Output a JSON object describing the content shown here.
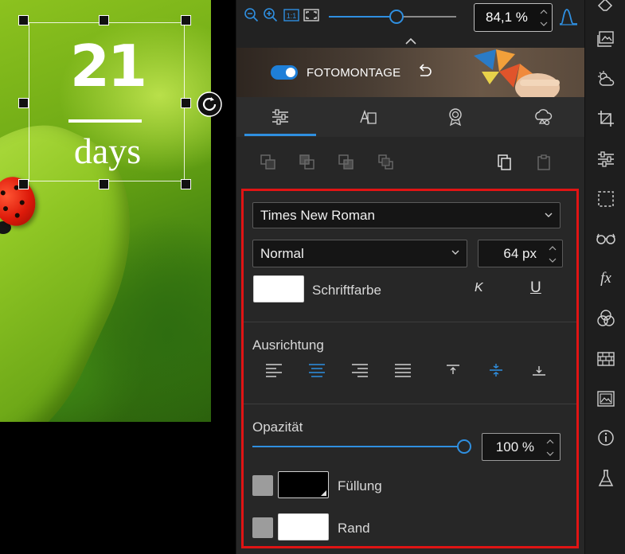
{
  "canvas": {
    "number_text": "21",
    "sub_text": "days"
  },
  "zoom": {
    "value_text": "84,1 %",
    "level": 0.53,
    "icons": [
      "zoom-out-icon",
      "zoom-in-icon",
      "actual-size-icon",
      "fit-screen-icon",
      "histogram-icon"
    ]
  },
  "banner": {
    "label": "FOTOMONTAGE",
    "toggle_on": true
  },
  "tabs": [
    {
      "name": "tab-adjustments",
      "icon": "sliders-icon",
      "active": true
    },
    {
      "name": "tab-text",
      "icon": "text-icon",
      "active": false
    },
    {
      "name": "tab-badge",
      "icon": "badge-icon",
      "active": false
    },
    {
      "name": "tab-shapes",
      "icon": "shapes-icon",
      "active": false
    }
  ],
  "text_settings": {
    "font_family": "Times New Roman",
    "font_style": "Normal",
    "font_size": "64 px",
    "color_label": "Schriftfarbe",
    "italic_label": "K",
    "underline_label": "U",
    "alignment_label": "Ausrichtung",
    "opacity_label": "Opazität",
    "opacity_value": "100 %",
    "opacity_level": 1.0,
    "fill_label": "Füllung",
    "border_label": "Rand",
    "colors": {
      "font_color": "#ffffff",
      "fill_color": "#000000",
      "border_color": "#ffffff",
      "accent": "#2f8fe0",
      "highlight_box": "#e01414"
    }
  },
  "toolbar": {
    "icons": [
      "eraser-icon",
      "image-stack-icon",
      "weather-icon",
      "crop-icon",
      "adjust-icon",
      "selection-icon",
      "glasses-icon",
      "fx-icon",
      "color-circles-icon",
      "brick-wall-icon",
      "image-frame-icon",
      "info-icon",
      "flask-icon"
    ],
    "fx_label": "fx"
  }
}
